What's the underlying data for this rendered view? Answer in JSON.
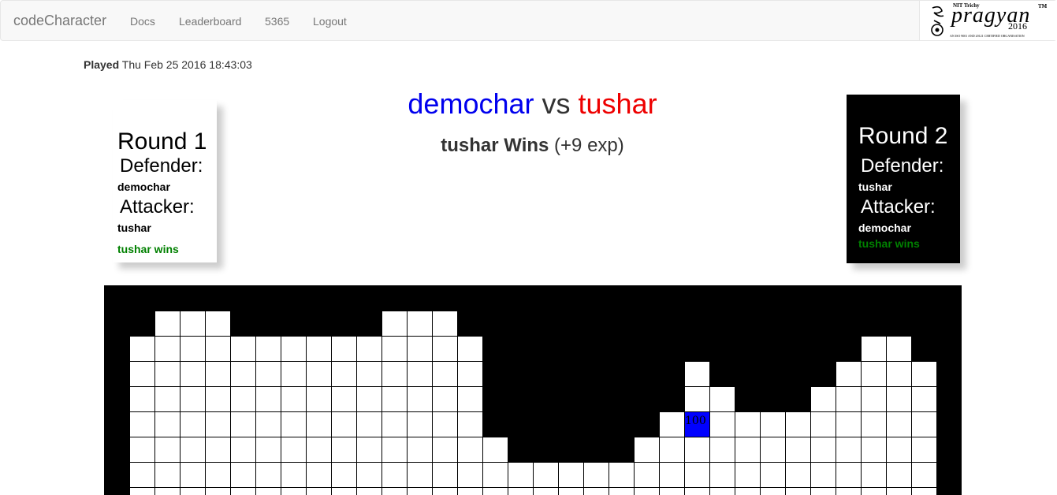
{
  "navbar": {
    "brand": "codeCharacter",
    "links": [
      "Docs",
      "Leaderboard",
      "5365",
      "Logout"
    ],
    "logo": {
      "top_text": "NIT Trichy",
      "word": "pragyan",
      "year": "2016",
      "tm": "TM",
      "tagline": "AN ISO 9001 AND 20121 CERTIFIED ORGANISATION"
    }
  },
  "match": {
    "played_label": "Played",
    "played_time": "Thu Feb 25 2016 18:43:03",
    "player1": "demochar",
    "vs": "vs",
    "player2": "tushar",
    "winner_text": "tushar Wins",
    "exp_text": "(+9 exp)",
    "colors": {
      "player1": "#0000ee",
      "player2": "#ee0000",
      "win": "#008000"
    }
  },
  "rounds": [
    {
      "title": "Round 1",
      "defender_label": "Defender:",
      "defender": "demochar",
      "attacker_label": "Attacker:",
      "attacker": "tushar",
      "result": "tushar wins"
    },
    {
      "title": "Round 2",
      "defender_label": "Defender:",
      "defender": "tushar",
      "attacker_label": "Attacker:",
      "attacker": "demochar",
      "result": "tushar wins"
    }
  ],
  "board": {
    "columns": 34,
    "column_tops": [
      99,
      2,
      1,
      1,
      1,
      2,
      2,
      2,
      2,
      2,
      2,
      1,
      1,
      1,
      2,
      6,
      7,
      7,
      7,
      7,
      7,
      6,
      5,
      3,
      4,
      5,
      5,
      5,
      4,
      3,
      2,
      2,
      3,
      99
    ],
    "highlight": {
      "col": 23,
      "row": 5,
      "value": "100",
      "color": "#0000ff"
    }
  }
}
